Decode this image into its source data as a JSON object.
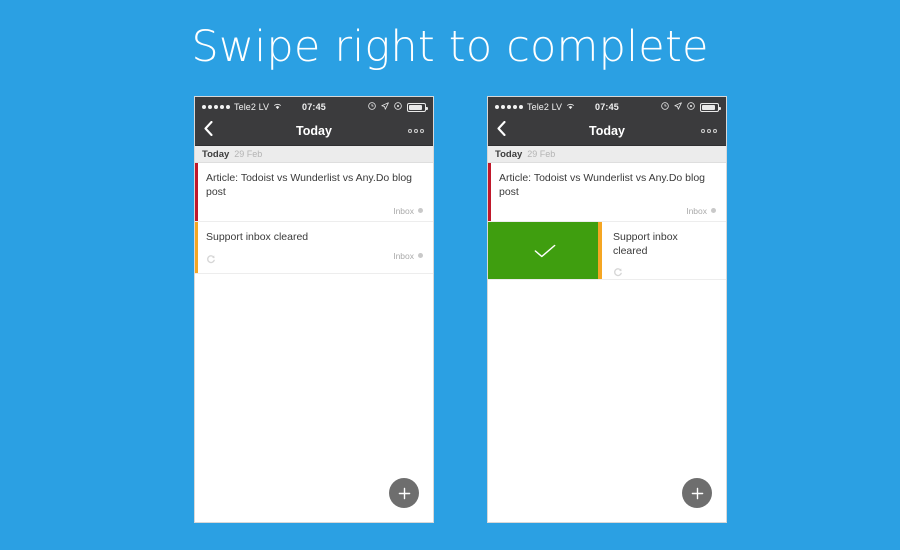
{
  "headline": "Swipe right to complete",
  "theme": {
    "background": "#2ba0e3",
    "navbar": "#3b3b3d",
    "section_header": "#ececec",
    "complete_green": "#3f9e0f",
    "priority_high": "#c0182b",
    "priority_medium": "#f5a623",
    "fab": "#6e6e6e"
  },
  "phones": [
    {
      "name": "before-swipe",
      "status_bar": {
        "signal_dots": 5,
        "carrier": "Tele2 LV",
        "wifi_icon": "wifi-icon",
        "time": "07:45",
        "alarm_icon": "alarm-icon",
        "location_icon": "location-arrow-icon",
        "rotation_lock_icon": "rotation-lock-icon",
        "battery_icon": "battery-icon"
      },
      "nav": {
        "back_icon": "chevron-left-icon",
        "title": "Today",
        "more_icon": "more-options-icon"
      },
      "section": {
        "title": "Today",
        "date": "29 Feb"
      },
      "tasks": [
        {
          "title": "Article: Todoist vs Wunderlist vs Any.Do blog post",
          "priority_color": "#c0182b",
          "list_label": "Inbox",
          "has_repeat": false,
          "completed": false
        },
        {
          "title": "Support inbox cleared",
          "priority_color": "#f5a623",
          "list_label": "Inbox",
          "has_repeat": true,
          "completed": false
        }
      ],
      "fab": {
        "icon": "plus-icon"
      }
    },
    {
      "name": "after-swipe",
      "status_bar": {
        "signal_dots": 5,
        "carrier": "Tele2 LV",
        "wifi_icon": "wifi-icon",
        "time": "07:45",
        "alarm_icon": "alarm-icon",
        "location_icon": "location-arrow-icon",
        "rotation_lock_icon": "rotation-lock-icon",
        "battery_icon": "battery-icon"
      },
      "nav": {
        "back_icon": "chevron-left-icon",
        "title": "Today",
        "more_icon": "more-options-icon"
      },
      "section": {
        "title": "Today",
        "date": "29 Feb"
      },
      "tasks": [
        {
          "title": "Article: Todoist vs Wunderlist vs Any.Do blog post",
          "priority_color": "#c0182b",
          "list_label": "Inbox",
          "has_repeat": false,
          "completed": false
        },
        {
          "title": "Support inbox cleared",
          "priority_color": "#f5a623",
          "list_label": "",
          "has_repeat": true,
          "completed": true,
          "swipe_action_icon": "checkmark-icon"
        }
      ],
      "fab": {
        "icon": "plus-icon"
      }
    }
  ]
}
